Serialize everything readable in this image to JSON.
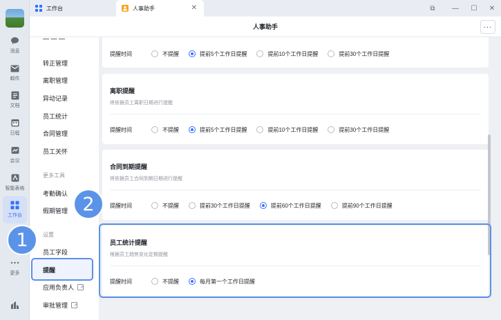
{
  "tabs": [
    {
      "label": "工作台",
      "icon": "grid-icon"
    },
    {
      "label": "人事助手",
      "icon": "hr-assistant-icon",
      "close": "✕"
    }
  ],
  "window": {
    "controls": [
      "⧉",
      "—",
      "☐",
      "✕"
    ]
  },
  "header": {
    "title": "人事助手",
    "more": "···"
  },
  "rail": {
    "items": [
      {
        "label": "消息",
        "icon": "chat-bubble-icon"
      },
      {
        "label": "邮件",
        "icon": "mail-icon"
      },
      {
        "label": "文档",
        "icon": "document-icon"
      },
      {
        "label": "日程",
        "icon": "calendar-icon"
      },
      {
        "label": "会议",
        "icon": "video-meeting-icon"
      },
      {
        "label": "智能表格",
        "icon": "smart-sheet-icon"
      },
      {
        "label": "工作台",
        "icon": "grid-icon",
        "active": true
      },
      {
        "label": "更多",
        "icon": "more-dots-icon"
      }
    ]
  },
  "sidemenu": {
    "items": [
      {
        "label": "转正管理"
      },
      {
        "label": "离职管理"
      },
      {
        "label": "异动记录"
      },
      {
        "label": "员工统计"
      },
      {
        "label": "合同管理"
      },
      {
        "label": "员工关怀"
      }
    ],
    "group_more_tools": "更多工具",
    "tools": [
      {
        "label": "考勤确认"
      },
      {
        "label": "假期管理"
      }
    ],
    "group_settings": "设置",
    "settings": [
      {
        "label": "员工字段"
      },
      {
        "label": "提醒",
        "active": true
      },
      {
        "label": "应用负责人",
        "external": true
      },
      {
        "label": "审批管理",
        "external": true
      }
    ]
  },
  "main": {
    "cards": [
      {
        "title": "",
        "desc": "",
        "row_label": "提醒时间",
        "options": [
          {
            "label": "不提醒",
            "selected": false
          },
          {
            "label": "提前5个工作日提醒",
            "selected": true
          },
          {
            "label": "提前10个工作日提醒",
            "selected": false
          },
          {
            "label": "提前30个工作日提醒",
            "selected": false
          }
        ]
      },
      {
        "title": "离职提醒",
        "desc": "将依据员工离职日期进行提醒",
        "row_label": "提醒时间",
        "options": [
          {
            "label": "不提醒",
            "selected": false
          },
          {
            "label": "提前5个工作日提醒",
            "selected": true
          },
          {
            "label": "提前10个工作日提醒",
            "selected": false
          },
          {
            "label": "提前30个工作日提醒",
            "selected": false
          }
        ]
      },
      {
        "title": "合同到期提醒",
        "desc": "将依据员工合同到期日期进行提醒",
        "row_label": "提醒时间",
        "options": [
          {
            "label": "不提醒",
            "selected": false
          },
          {
            "label": "提前30个工作日提醒",
            "selected": false
          },
          {
            "label": "提前60个工作日提醒",
            "selected": true
          },
          {
            "label": "提前90个工作日提醒",
            "selected": false
          }
        ]
      },
      {
        "title": "员工统计提醒",
        "desc": "根据员工趋势变化定期提醒",
        "row_label": "提醒时间",
        "options": [
          {
            "label": "不提醒",
            "selected": false
          },
          {
            "label": "每月第一个工作日提醒",
            "selected": true
          }
        ]
      }
    ]
  },
  "annotations": {
    "badge1": "1",
    "badge2": "2"
  },
  "colors": {
    "accent": "#3370ff",
    "highlight": "#5c8fe6",
    "badge": "#5b93e8"
  }
}
